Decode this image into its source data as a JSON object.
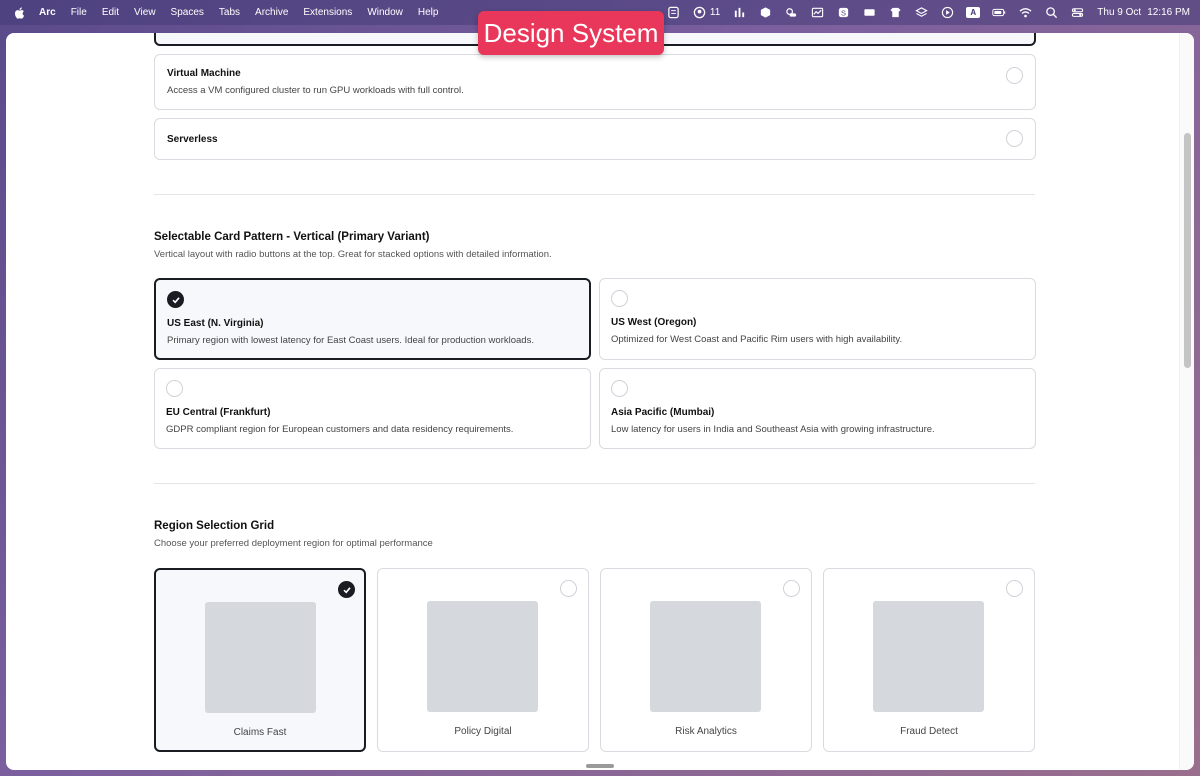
{
  "menubar": {
    "app": "Arc",
    "items": [
      "File",
      "Edit",
      "View",
      "Spaces",
      "Tabs",
      "Archive",
      "Extensions",
      "Window",
      "Help"
    ],
    "github_count": "11",
    "input_source": "A",
    "clock": {
      "date": "Thu 9 Oct",
      "time": "12:16 PM"
    }
  },
  "badge": {
    "label": "Design System"
  },
  "deployment_cards": [
    {
      "title": "Virtual Machine",
      "description": "Access a VM configured cluster to run GPU workloads with full control."
    },
    {
      "title": "Serverless",
      "description": ""
    }
  ],
  "vertical_section": {
    "title": "Selectable Card Pattern - Vertical (Primary Variant)",
    "description": "Vertical layout with radio buttons at the top. Great for stacked options with detailed information.",
    "cards": [
      {
        "title": "US East (N. Virginia)",
        "description": "Primary region with lowest latency for East Coast users. Ideal for production workloads.",
        "selected": true
      },
      {
        "title": "US West (Oregon)",
        "description": "Optimized for West Coast and Pacific Rim users with high availability.",
        "selected": false
      },
      {
        "title": "EU Central (Frankfurt)",
        "description": "GDPR compliant region for European customers and data residency requirements.",
        "selected": false
      },
      {
        "title": "Asia Pacific (Mumbai)",
        "description": "Low latency for users in India and Southeast Asia with growing infrastructure.",
        "selected": false
      }
    ]
  },
  "region_grid": {
    "title": "Region Selection Grid",
    "description": "Choose your preferred deployment region for optimal performance",
    "cards": [
      {
        "label": "Claims Fast",
        "selected": true
      },
      {
        "label": "Policy Digital",
        "selected": false
      },
      {
        "label": "Risk Analytics",
        "selected": false
      },
      {
        "label": "Fraud Detect",
        "selected": false
      }
    ]
  },
  "colors": {
    "accent": "#1a1c24",
    "badge": "#e8375a",
    "border": "#d9dbe0",
    "placeholder": "#d5d8dd"
  }
}
